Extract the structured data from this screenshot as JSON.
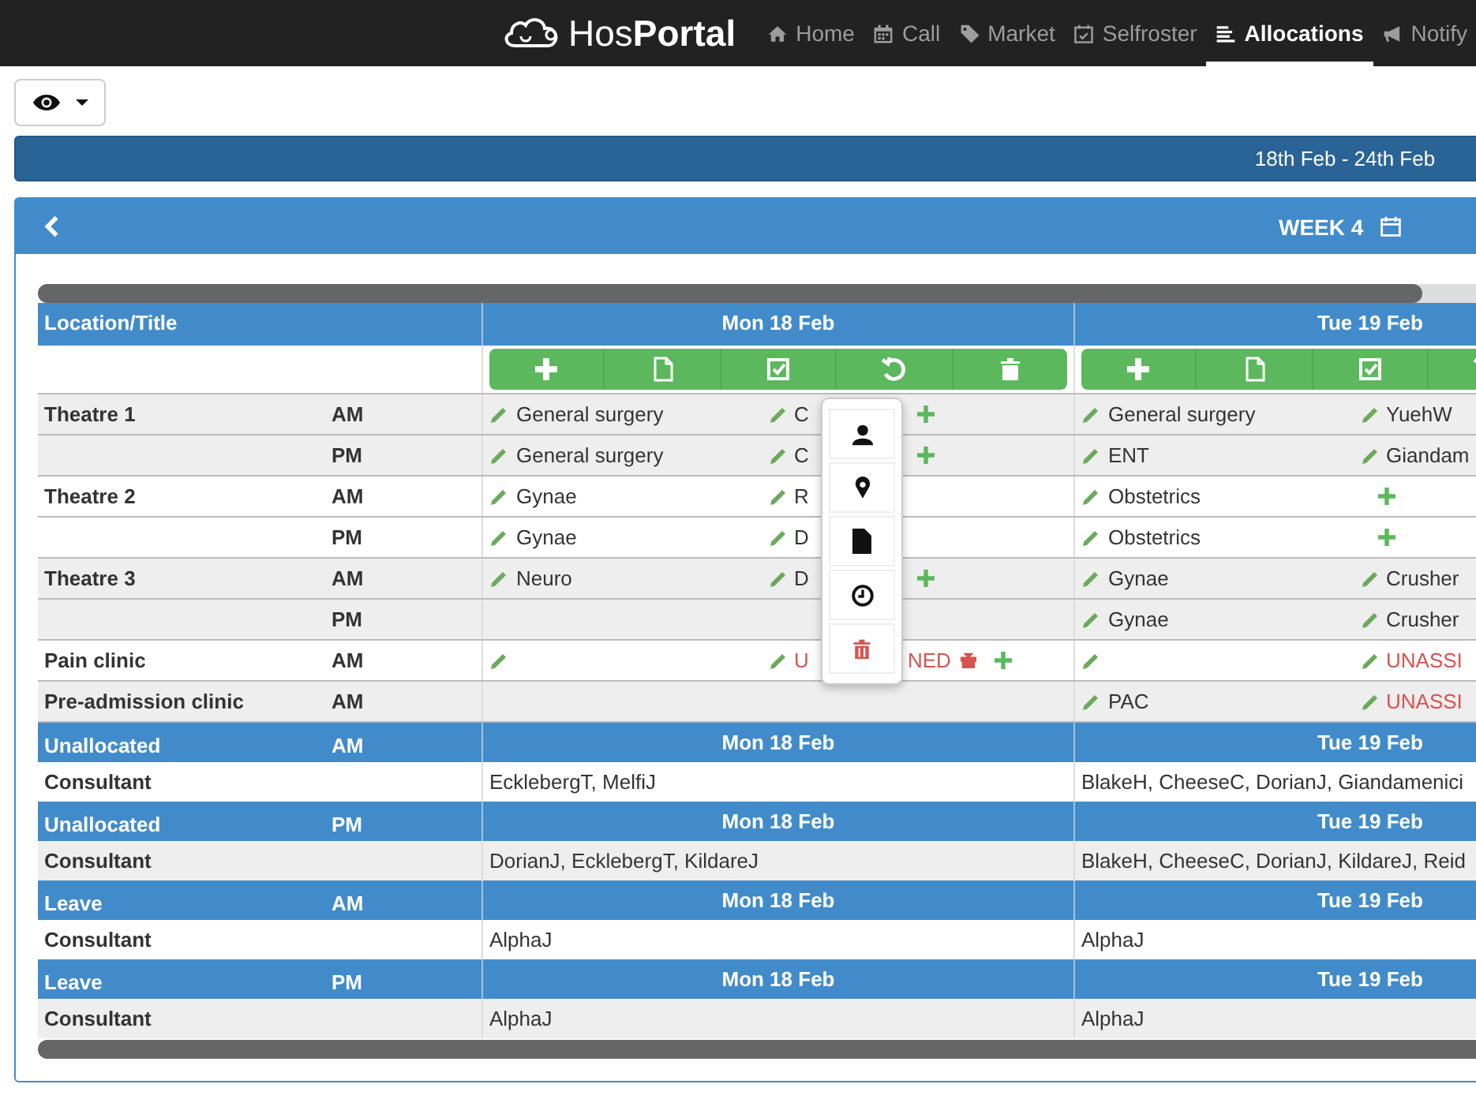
{
  "nav": {
    "brand": "Hos**Portal**",
    "items": [
      {
        "label": "Home",
        "selected": false
      },
      {
        "label": "Call",
        "selected": false
      },
      {
        "label": "Market",
        "selected": false
      },
      {
        "label": "Selfroster",
        "selected": false
      },
      {
        "label": "Allocations",
        "selected": true
      },
      {
        "label": "Notify",
        "selected": false
      }
    ]
  },
  "date_range": "18th Feb - 24th Feb",
  "week": {
    "label": "WEEK 4"
  },
  "table": {
    "header": "Location/Title",
    "days": [
      {
        "label": "Mon 18 Feb",
        "menu_open": true
      },
      {
        "label": "Tue 19 Feb"
      }
    ],
    "locations": [
      {
        "name": "Theatre 1",
        "sessions": [
          {
            "session": "AM",
            "cells": [
              {
                "specialty": "General surgery",
                "editable": true,
                "person": "C",
                "person_editable": true,
                "plus": true
              },
              {
                "specialty": "General surgery",
                "editable": true,
                "person": "YuehW",
                "person_editable": true
              }
            ]
          },
          {
            "session": "PM",
            "cells": [
              {
                "specialty": "General surgery",
                "editable": true,
                "person": "C",
                "person_editable": true,
                "plus": true
              },
              {
                "specialty": "ENT",
                "editable": true,
                "person": "Giandam",
                "person_editable": true
              }
            ]
          }
        ]
      },
      {
        "name": "Theatre 2",
        "sessions": [
          {
            "session": "AM",
            "cells": [
              {
                "specialty": "Gynae",
                "editable": true,
                "person": "R",
                "person_editable": true
              },
              {
                "specialty": "Obstetrics",
                "editable": true,
                "plus": true
              }
            ]
          },
          {
            "session": "PM",
            "cells": [
              {
                "specialty": "Gynae",
                "editable": true,
                "person": "D",
                "person_editable": true
              },
              {
                "specialty": "Obstetrics",
                "editable": true,
                "plus": true
              }
            ]
          }
        ]
      },
      {
        "name": "Theatre 3",
        "sessions": [
          {
            "session": "AM",
            "cells": [
              {
                "specialty": "Neuro",
                "editable": true,
                "person": "D",
                "person_editable": true,
                "plus": true
              },
              {
                "specialty": "Gynae",
                "editable": true,
                "person": "Crusher",
                "person_editable": true
              }
            ]
          },
          {
            "session": "PM",
            "cells": [
              {},
              {
                "specialty": "Gynae",
                "editable": true,
                "person": "Crusher",
                "person_editable": true
              }
            ]
          }
        ]
      },
      {
        "name": "Pain clinic",
        "sessions": [
          {
            "session": "AM",
            "cells": [
              {
                "editable": true,
                "person": "U",
                "person_tail": "NED",
                "person_editable": true,
                "unassigned": true,
                "gift": true,
                "plus": true
              },
              {
                "editable": true,
                "person": "UNASSI",
                "person_editable": true,
                "unassigned": true
              }
            ]
          }
        ]
      },
      {
        "name": "Pre-admission clinic",
        "sessions": [
          {
            "session": "AM",
            "cells": [
              {},
              {
                "specialty": "PAC",
                "editable": true,
                "person": "UNASSI",
                "person_editable": true,
                "unassigned": true
              }
            ]
          }
        ]
      }
    ]
  },
  "summary_blocks": [
    {
      "title": "Unallocated",
      "session": "AM",
      "days": [
        "Mon 18 Feb",
        "Tue 19 Feb"
      ],
      "role": "Consultant",
      "names": [
        "EcklebergT, MelfiJ",
        "BlakeH, CheeseC, DorianJ, Giandamenici"
      ]
    },
    {
      "title": "Unallocated",
      "session": "PM",
      "days": [
        "Mon 18 Feb",
        "Tue 19 Feb"
      ],
      "role": "Consultant",
      "names": [
        "DorianJ, EcklebergT, KildareJ",
        "BlakeH, CheeseC, DorianJ, KildareJ, Reid"
      ]
    },
    {
      "title": "Leave",
      "session": "AM",
      "days": [
        "Mon 18 Feb",
        "Tue 19 Feb"
      ],
      "role": "Consultant",
      "names": [
        "AlphaJ",
        "AlphaJ"
      ]
    },
    {
      "title": "Leave",
      "session": "PM",
      "days": [
        "Mon 18 Feb",
        "Tue 19 Feb"
      ],
      "role": "Consultant",
      "names": [
        "AlphaJ",
        "AlphaJ"
      ]
    }
  ]
}
